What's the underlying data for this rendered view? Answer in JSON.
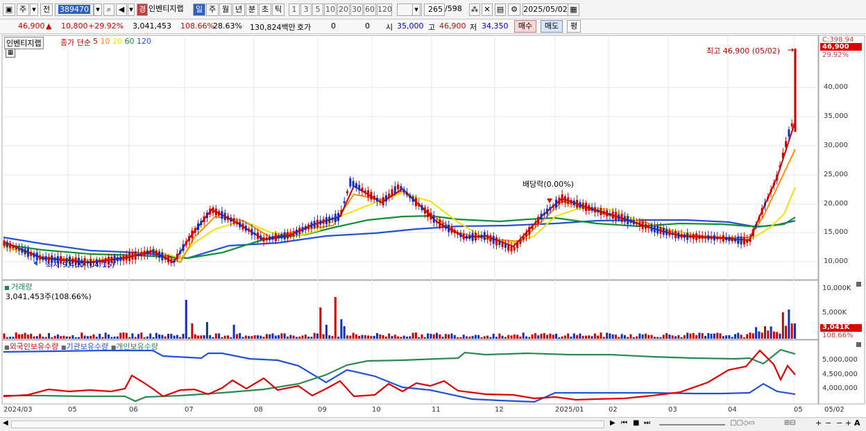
{
  "toolbar": {
    "market": "주",
    "prev": "전",
    "stock_code": "389470",
    "warn_badge": "경",
    "stock_name": "인벤티지랩",
    "periods": [
      "일",
      "주",
      "월",
      "년",
      "분",
      "초",
      "틱"
    ],
    "active_period": "일",
    "intervals": [
      "1",
      "3",
      "5",
      "10",
      "20",
      "30",
      "60",
      "120"
    ],
    "count": "265",
    "total": "/598",
    "date": "2025/05/02"
  },
  "info": {
    "price": "46,900",
    "change": "10,800",
    "change_pct": "+29.92%",
    "volume": "3,041,453",
    "vol_ratio": "108.66%",
    "turnover_pct": "28.63%",
    "amount": "130,824백만",
    "quote_label": "호가",
    "bid": "0",
    "ask": "0",
    "open_label": "시",
    "open": "35,000",
    "high_label": "고",
    "high": "46,900",
    "low_label": "저",
    "low": "34,350",
    "buy_label": "매수",
    "sell_label": "매도",
    "eval_label": "평"
  },
  "price_panel": {
    "name": "인벤티지랩",
    "ma_title": "종가 단순",
    "ma_periods": [
      "5",
      "10",
      "20",
      "60",
      "120"
    ],
    "ma_colors": [
      "#d00000",
      "#ff8c00",
      "#f0e000",
      "#109030",
      "#2050e0"
    ],
    "high_note": "최고 46,900 (05/02)",
    "low_note": "최저 9,400 (04/15)",
    "dividend_note": "배당락(0.00%)",
    "y_ticks": [
      "40,000",
      "35,000",
      "30,000",
      "25,000",
      "20,000",
      "15,000",
      "10,000"
    ],
    "top_value": "C:398.94",
    "price_tag": "46,900",
    "pct_tag": "29.92%"
  },
  "volume_panel": {
    "title": "거래량",
    "value": "3,041,453주(108.66%)",
    "y_ticks": [
      "10,000K",
      "5,000K"
    ],
    "tag": "3,041K",
    "tag_pct": "108.66%"
  },
  "holding_panel": {
    "legend": [
      "외국인보유수량",
      "기관보유수량",
      "개인보유수량"
    ],
    "colors": [
      "#e00000",
      "#2050e0",
      "#2a8a50"
    ],
    "y_ticks": [
      "5,000,000",
      "4,500,000",
      "4,000,000"
    ]
  },
  "x_axis": [
    "2024/03",
    "05",
    "06",
    "07",
    "08",
    "09",
    "10",
    "11",
    "12",
    "2025/01",
    "02",
    "03",
    "04",
    "05"
  ],
  "x_axis_right": "05/02"
}
